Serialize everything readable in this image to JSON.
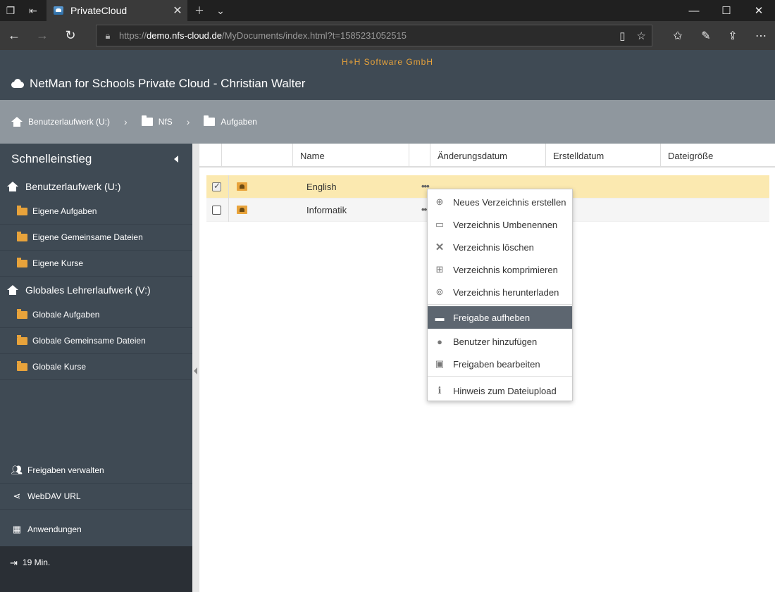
{
  "browser": {
    "tab_title": "PrivateCloud",
    "url_prefix": "https://",
    "url_host": "demo.nfs-cloud.de",
    "url_path": "/MyDocuments/index.html?t=1585231052515"
  },
  "header": {
    "company": "H+H Software GmbH",
    "title": "NetMan for Schools Private Cloud - Christian Walter"
  },
  "breadcrumb": [
    "Benutzerlaufwerk (U:)",
    "NfS",
    "Aufgaben"
  ],
  "sidebar": {
    "title": "Schnelleinstieg",
    "groups": [
      {
        "label": "Benutzerlaufwerk (U:)",
        "items": [
          "Eigene Aufgaben",
          "Eigene Gemeinsame Dateien",
          "Eigene Kurse"
        ]
      },
      {
        "label": "Globales Lehrerlaufwerk (V:)",
        "items": [
          "Globale Aufgaben",
          "Globale Gemeinsame Dateien",
          "Globale Kurse"
        ]
      }
    ],
    "bottom": [
      "Freigaben verwalten",
      "WebDAV URL",
      "Anwendungen"
    ],
    "session": "19 Min."
  },
  "table": {
    "columns": [
      "Name",
      "Änderungsdatum",
      "Erstelldatum",
      "Dateigröße"
    ],
    "rows": [
      {
        "name": "English",
        "selected": true
      },
      {
        "name": "Informatik",
        "selected": false
      }
    ]
  },
  "context_menu": {
    "items": [
      "Neues Verzeichnis erstellen",
      "Verzeichnis Umbenennen",
      "Verzeichnis löschen",
      "Verzeichnis komprimieren",
      "Verzeichnis herunterladen",
      "Freigabe aufheben",
      "Benutzer hinzufügen",
      "Freigaben bearbeiten",
      "Hinweis zum Dateiupload"
    ],
    "highlighted": "Freigabe aufheben"
  },
  "colors": {
    "header_bg": "#3f4a54",
    "accent": "#e8a33b",
    "breadcrumb_bg": "#8f979e",
    "selected_row": "#fbe9b0",
    "menu_highlight": "#5d6670"
  }
}
